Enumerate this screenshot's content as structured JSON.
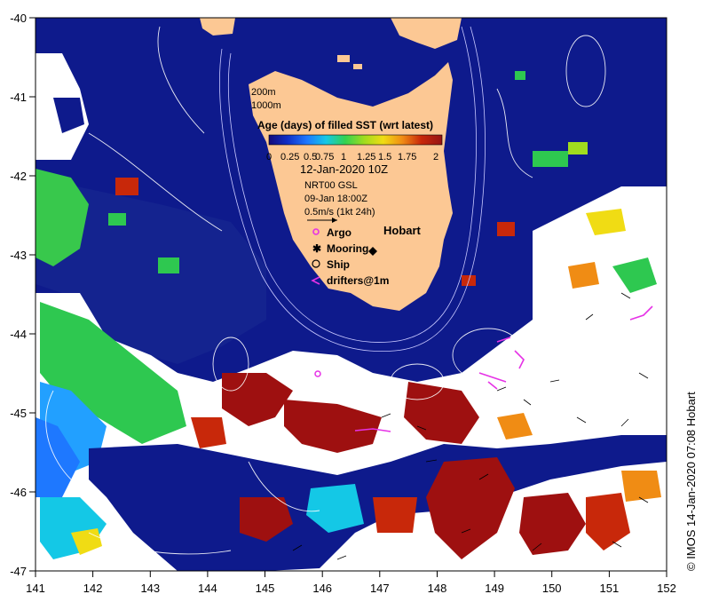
{
  "map": {
    "region": "Tasmania",
    "place_label": "Hobart",
    "isobath_labels": [
      "200m",
      "1000m"
    ],
    "colorbar": {
      "title": "Age (days) of filled SST (wrt latest)",
      "ticks": [
        "0",
        "0.25",
        "0.5",
        "0.75",
        "1",
        "1.25",
        "1.5",
        "1.75",
        "2"
      ],
      "colors": [
        "#140a7a",
        "#1030c8",
        "#1e78ff",
        "#14c8e6",
        "#32d250",
        "#a0dc1e",
        "#f0dc14",
        "#f08c14",
        "#c8280a",
        "#961414"
      ]
    },
    "date": "12-Jan-2020 10Z",
    "product": "NRT00 GSL",
    "currents_time": "09-Jan 18:00Z",
    "vector_scale": "0.5m/s (1kt 24h)",
    "symbols": {
      "argo": "Argo",
      "mooring": "Mooring",
      "ship": "Ship",
      "drifters": "drifters@1m"
    },
    "credit": "© IMOS 14-Jan-2020 07:08 Hobart",
    "x_ticks": [
      "141",
      "142",
      "143",
      "144",
      "145",
      "146",
      "147",
      "148",
      "149",
      "150",
      "151",
      "152"
    ],
    "y_ticks": [
      "-40",
      "-41",
      "-42",
      "-43",
      "-44",
      "-45",
      "-46",
      "-47"
    ],
    "colors": {
      "land": "#fcc894",
      "deep_navy": "#0e1a8c",
      "no_data": "#ffffff",
      "drifter": "#e632e6"
    }
  }
}
